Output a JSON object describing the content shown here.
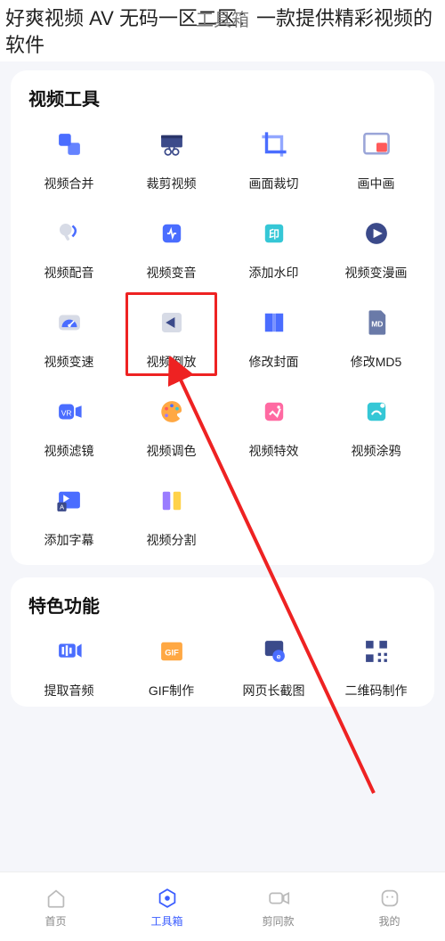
{
  "page_header": "好爽视频 AV 无码一区二区：一款提供精彩视频的软件",
  "screen_title": "工具箱",
  "sections": {
    "video_tools": {
      "title": "视频工具",
      "items": [
        {
          "id": "merge-video",
          "label": "视频合并",
          "highlight": false
        },
        {
          "id": "trim-video",
          "label": "裁剪视频",
          "highlight": false
        },
        {
          "id": "crop-frame",
          "label": "画面裁切",
          "highlight": false
        },
        {
          "id": "pip",
          "label": "画中画",
          "highlight": false
        },
        {
          "id": "dub-video",
          "label": "视频配音",
          "highlight": false
        },
        {
          "id": "change-voice",
          "label": "视频变音",
          "highlight": false
        },
        {
          "id": "add-watermark",
          "label": "添加水印",
          "highlight": false
        },
        {
          "id": "to-comic",
          "label": "视频变漫画",
          "highlight": false
        },
        {
          "id": "change-speed",
          "label": "视频变速",
          "highlight": false
        },
        {
          "id": "reverse-video",
          "label": "视频倒放",
          "highlight": true
        },
        {
          "id": "change-cover",
          "label": "修改封面",
          "highlight": false
        },
        {
          "id": "change-md5",
          "label": "修改MD5",
          "highlight": false
        },
        {
          "id": "video-filter",
          "label": "视频滤镜",
          "highlight": false
        },
        {
          "id": "color-adjust",
          "label": "视频调色",
          "highlight": false
        },
        {
          "id": "video-fx",
          "label": "视频特效",
          "highlight": false
        },
        {
          "id": "video-doodle",
          "label": "视频涂鸦",
          "highlight": false
        },
        {
          "id": "add-subtitle",
          "label": "添加字幕",
          "highlight": false
        },
        {
          "id": "split-video",
          "label": "视频分割",
          "highlight": false
        }
      ]
    },
    "special": {
      "title": "特色功能",
      "items": [
        {
          "id": "extract-audio",
          "label": "提取音频"
        },
        {
          "id": "make-gif",
          "label": "GIF制作"
        },
        {
          "id": "long-screenshot",
          "label": "网页长截图"
        },
        {
          "id": "make-qrcode",
          "label": "二维码制作"
        }
      ]
    }
  },
  "tabs": [
    {
      "id": "home",
      "label": "首页",
      "active": false
    },
    {
      "id": "toolbox",
      "label": "工具箱",
      "active": true
    },
    {
      "id": "clip-same",
      "label": "剪同款",
      "active": false
    },
    {
      "id": "mine",
      "label": "我的",
      "active": false
    }
  ],
  "icon_colors": {
    "blue": "#4a6dff",
    "cyan": "#35c7d6",
    "red": "#ff5a5a",
    "orange": "#ffa843",
    "pink": "#ff6aa2",
    "purple": "#9a7cff",
    "gray": "#d7dbe6"
  }
}
